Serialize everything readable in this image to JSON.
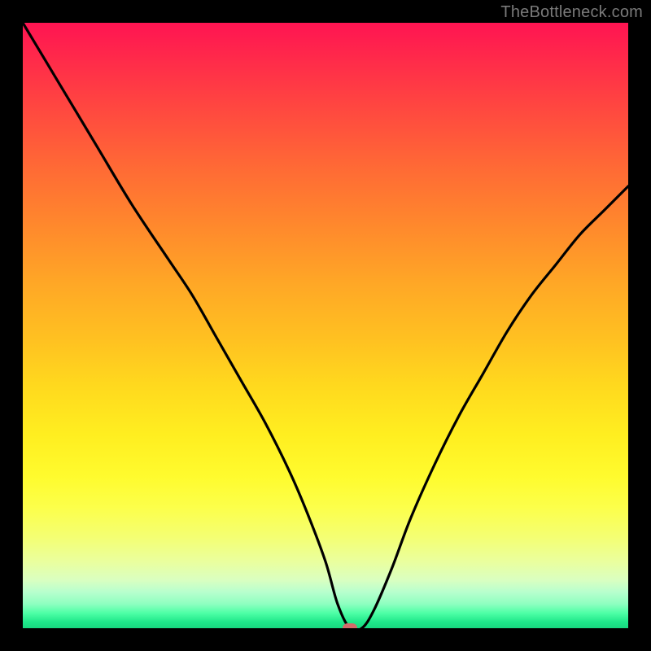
{
  "watermark": "TheBottleneck.com",
  "chart_data": {
    "type": "line",
    "title": "",
    "xlabel": "",
    "ylabel": "",
    "xlim": [
      0,
      100
    ],
    "ylim": [
      0,
      100
    ],
    "marker": {
      "x": 54,
      "y": 0
    },
    "series": [
      {
        "name": "curve",
        "x": [
          0,
          6,
          12,
          18,
          24,
          28,
          32,
          36,
          40,
          44,
          47,
          50,
          52,
          54,
          56,
          58,
          61,
          64,
          68,
          72,
          76,
          80,
          84,
          88,
          92,
          96,
          100
        ],
        "values": [
          100,
          90,
          80,
          70,
          61,
          55,
          48,
          41,
          34,
          26,
          19,
          11,
          4,
          0,
          0,
          3,
          10,
          18,
          27,
          35,
          42,
          49,
          55,
          60,
          65,
          69,
          73
        ]
      }
    ]
  }
}
